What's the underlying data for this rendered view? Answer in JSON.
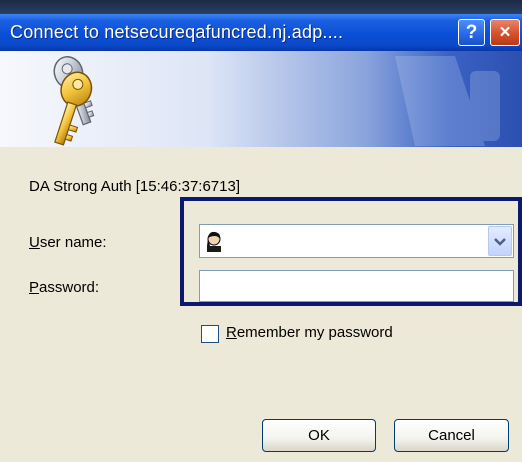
{
  "dialog": {
    "title": "Connect to netsecureqafuncred.nj.adp....",
    "help_label": "?",
    "close_label": "×",
    "realm": "DA Strong Auth [15:46:37:6713]"
  },
  "form": {
    "username_label_underlined": "U",
    "username_label_rest": "ser name:",
    "username_value": "",
    "password_label_underlined": "P",
    "password_label_rest": "assword:",
    "password_value": "",
    "remember_label_underlined": "R",
    "remember_label_rest": "emember my password",
    "remember_checked": false
  },
  "buttons": {
    "ok": "OK",
    "cancel": "Cancel"
  },
  "icons": {
    "banner": "keys-icon",
    "user": "user-icon",
    "dropdown": "chevron-down-icon"
  }
}
